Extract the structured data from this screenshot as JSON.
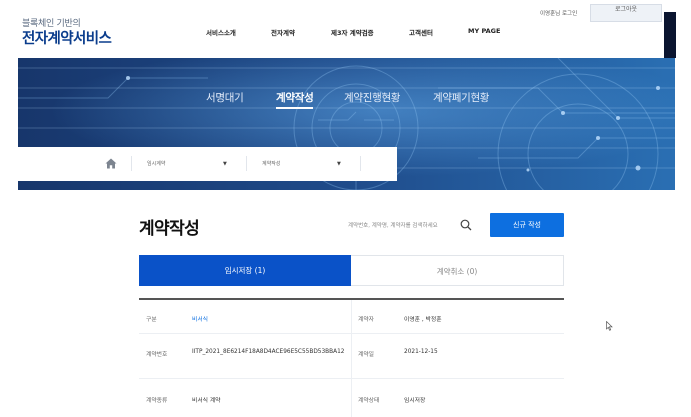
{
  "brand": {
    "subtitle": "블록체인 기반의",
    "title": "전자계약서비스"
  },
  "gnb": {
    "items": [
      "서비스소개",
      "전자계약",
      "제3자 계약검증",
      "고객센터",
      "MY PAGE"
    ]
  },
  "utility": {
    "greeting": "이영훈님 로그인",
    "button_label": "로그아웃"
  },
  "hero": {
    "tabs": [
      "서명대기",
      "계약작성",
      "계약진행현황",
      "계약폐기현황"
    ],
    "active_tab": "계약작성"
  },
  "breadcrumb": {
    "level1": "임시계약",
    "level2": "계약작성"
  },
  "page": {
    "title": "계약작성"
  },
  "search": {
    "placeholder": "계약번호, 계약명, 계약자를 검색하세요"
  },
  "new_contract_button": "신규 작성",
  "tabs": {
    "draft": "임시저장 (1)",
    "cancel": "계약취소 (0)"
  },
  "detail": {
    "row1": {
      "label_left": "구분",
      "value_left": "비서식",
      "label_right": "계약자",
      "value_right": "이영훈 , 박정훈"
    },
    "row2": {
      "label_left": "계약번호",
      "value_left": "IITP_2021_8E6214F18A8D4ACE96E5C55BD53BBA12",
      "label_right": "계약일",
      "value_right": "2021-12-15"
    },
    "row3": {
      "label_left": "계약종류",
      "value_left": "비서식 계약",
      "label_right": "계약상태",
      "value_right": "임시저장"
    }
  },
  "colors": {
    "brand_navy": "#0a3c8c",
    "primary_blue": "#0d6fe0",
    "tab_active": "#0a52c8",
    "hero_bg": "#1c3f78"
  }
}
